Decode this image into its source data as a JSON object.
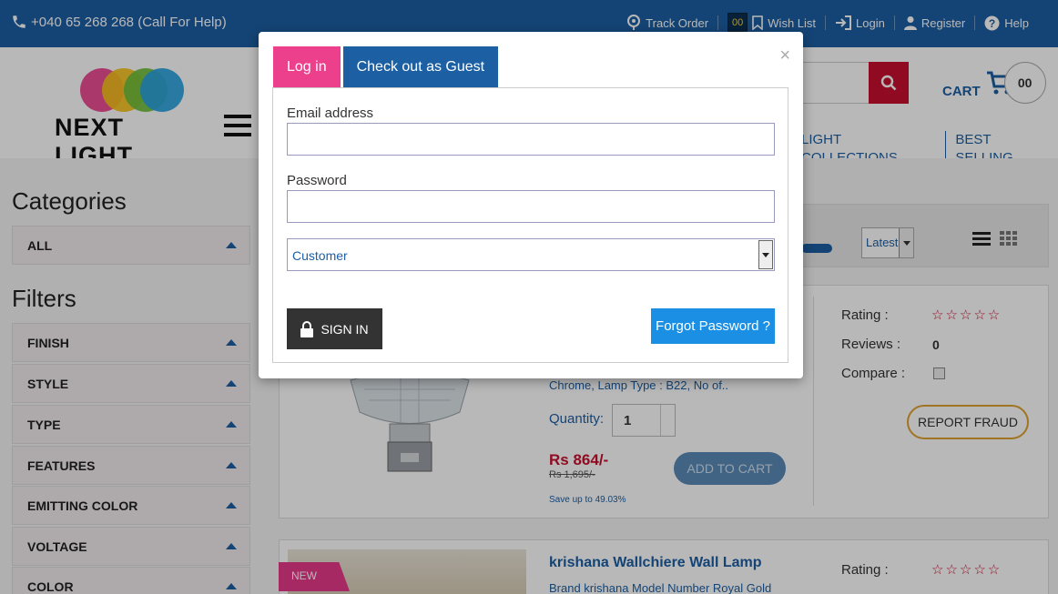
{
  "topbar": {
    "phone": "+040 65 268 268 (Call For Help)",
    "links": {
      "track_order": "Track Order",
      "wishlist_count": "00",
      "wish_list": "Wish List",
      "login": "Login",
      "register": "Register",
      "help": "Help"
    }
  },
  "header": {
    "logo_text": "NEXT LIGHT",
    "cart_label": "CART",
    "cart_count": "00",
    "nav": [
      "LIGHT COLLECTIONS",
      "BEST SELLING"
    ]
  },
  "sidebar": {
    "categories_title": "Categories",
    "categories": [
      "ALL"
    ],
    "filters_title": "Filters",
    "filters": [
      "FINISH",
      "STYLE",
      "TYPE",
      "FEATURES",
      "EMITTING COLOR",
      "VOLTAGE",
      "COLOR"
    ]
  },
  "toolbar": {
    "sort_value": "Latest"
  },
  "products": [
    {
      "specs": "Chrome, Lamp Type : B22, No of..",
      "quantity_label": "Quantity:",
      "quantity": "1",
      "price": "Rs 864/-",
      "old_price": "Rs 1,695/-",
      "save": "Save up to 49.03%",
      "add_to_cart": "ADD TO CART",
      "rating_label": "Rating :",
      "reviews_label": "Reviews :",
      "reviews_count": "0",
      "compare_label": "Compare :",
      "report_fraud": "REPORT FRAUD",
      "stars": "☆☆☆☆☆"
    },
    {
      "tag": "NEW",
      "title": "krishana Wallchiere Wall Lamp",
      "desc": "Brand krishana Model Number Royal Gold",
      "rating_label": "Rating :",
      "stars": "☆☆☆☆☆"
    }
  ],
  "modal": {
    "tabs": [
      "Log in",
      "Check out as Guest"
    ],
    "email_label": "Email address",
    "email_value": "",
    "password_label": "Password",
    "password_value": "",
    "role_selected": "Customer",
    "signin_label": "SIGN IN",
    "forgot_label": "Forgot Password ?",
    "close_glyph": "×"
  },
  "colors": {
    "brand_blue": "#1c5fa3",
    "login_tab_pink": "#ec3f8c",
    "search_red": "#c8102e",
    "forgot_blue": "#1a8fe3"
  }
}
